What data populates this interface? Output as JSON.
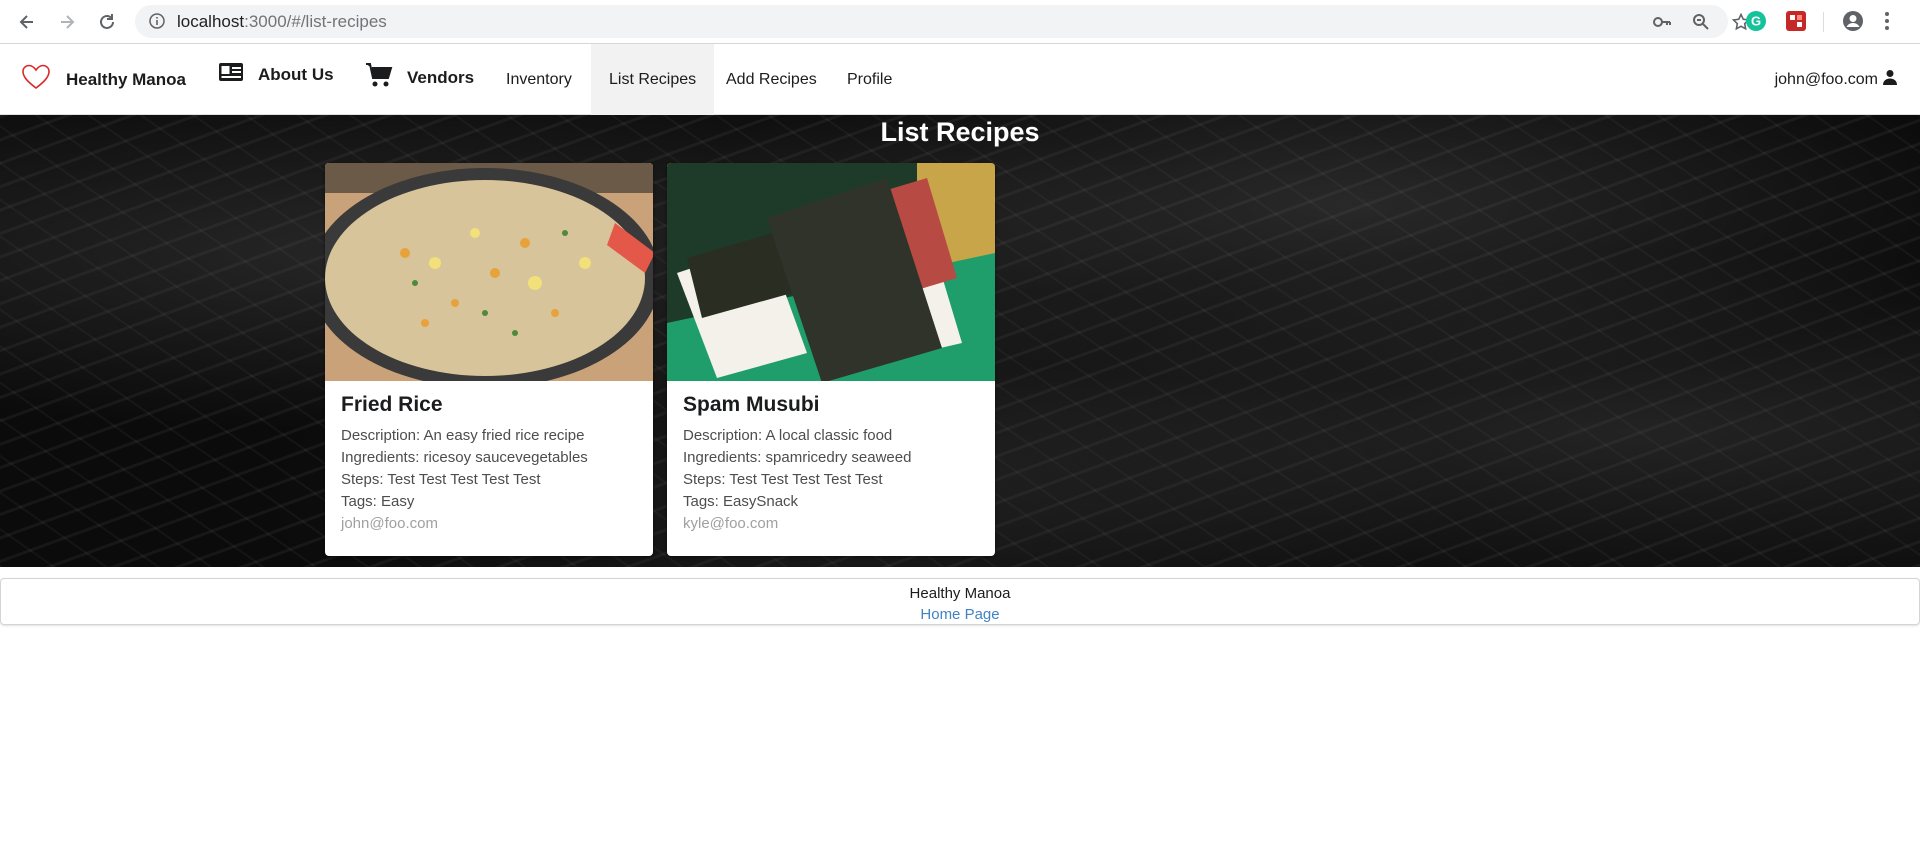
{
  "browser": {
    "url_host": "localhost",
    "url_rest": ":3000/#/list-recipes"
  },
  "icons": {
    "back": "arrow-left-icon",
    "forward": "arrow-right-icon",
    "reload": "reload-icon",
    "info": "info-icon",
    "key": "key-icon",
    "zoom": "magnifier-icon",
    "star": "star-icon",
    "grammarly": "grammarly-icon",
    "extension": "extension-icon",
    "account": "account-icon",
    "menu": "kebab-menu-icon"
  },
  "nav": {
    "brand": "Healthy Manoa",
    "about": "About Us",
    "vendors": "Vendors",
    "inventory": "Inventory",
    "list_recipes": "List Recipes",
    "add_recipes": "Add Recipes",
    "profile": "Profile",
    "user": "john@foo.com"
  },
  "page": {
    "title": "List Recipes"
  },
  "recipes": [
    {
      "name": "Fried Rice",
      "description": "Description: An easy fried rice recipe",
      "ingredients": "Ingredients: ricesoy saucevegetables",
      "steps": "Steps: Test Test Test Test Test",
      "tags": "Tags: Easy",
      "owner": "john@foo.com"
    },
    {
      "name": "Spam Musubi",
      "description": "Description: A local classic food",
      "ingredients": "Ingredients: spamricedry seaweed",
      "steps": "Steps: Test Test Test Test Test",
      "tags": "Tags: EasySnack",
      "owner": "kyle@foo.com"
    }
  ],
  "footer": {
    "name": "Healthy Manoa",
    "link": "Home Page"
  },
  "colors": {
    "link": "#4183c4",
    "heart": "#db2828",
    "grammarly": "#15c39a"
  }
}
